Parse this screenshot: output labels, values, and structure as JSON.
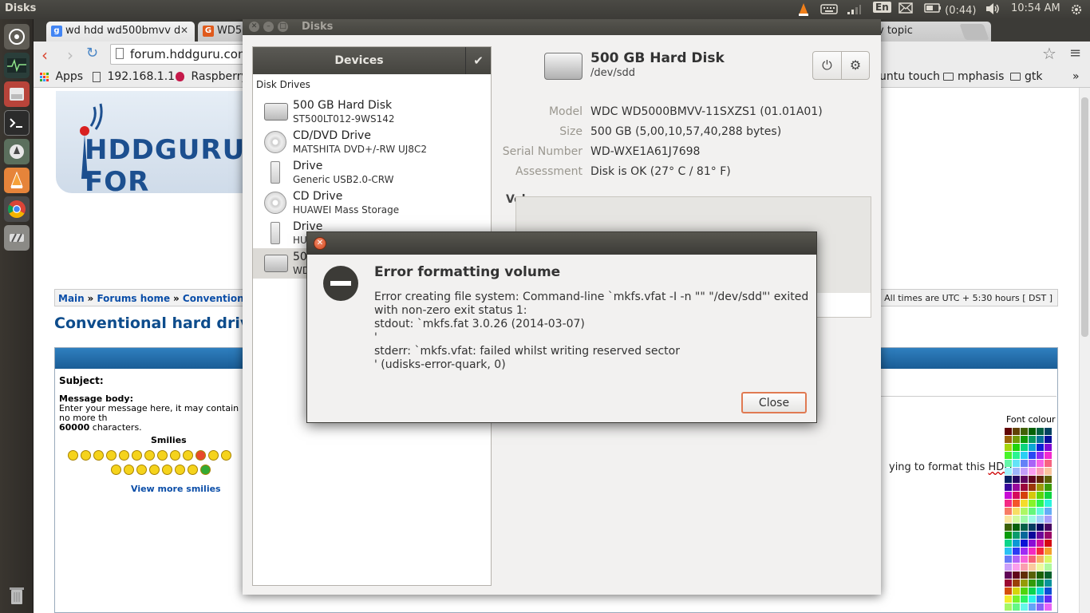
{
  "panel": {
    "app_title": "Disks",
    "battery": "(0:44)",
    "clock": "10:54 AM",
    "keyboard_lang": "En"
  },
  "browser": {
    "tabs": [
      {
        "label": "wd hdd wd500bmvv d",
        "favicon": "google-icon"
      },
      {
        "label": "WD5",
        "favicon": "hddguru-icon"
      },
      {
        "label": "v topic",
        "favicon": ""
      }
    ],
    "url": "forum.hddguru.com",
    "bookmarks": [
      {
        "label": "Apps"
      },
      {
        "label": "192.168.1.1"
      },
      {
        "label": "Raspberry"
      },
      {
        "label": "untu touch"
      },
      {
        "label": "mphasis"
      },
      {
        "label": "gtk"
      }
    ],
    "page": {
      "logo_text": "HDDGURU FOR",
      "breadcrumb": [
        "Main",
        "Forums home",
        "Conventional har"
      ],
      "timezone": "All times are UTC + 5:30 hours [ DST ]",
      "title": "Conventional hard drives",
      "subject_label": "Subject:",
      "message_label": "Message body:",
      "message_hint": "Enter your message here, it may contain no more th",
      "message_limit": "60000",
      "message_limit_suffix": " characters.",
      "smilies_label": "Smilies",
      "more_smilies": "View more smilies",
      "helper_text_prefix": "ying to format this ",
      "helper_text_word": "HDD",
      "font_colour_label": "Font colour"
    }
  },
  "disks": {
    "window_title": "Disks",
    "devices_header": "Devices",
    "section_label": "Disk Drives",
    "devices": [
      {
        "name": "500 GB Hard Disk",
        "sub": "ST500LT012-9WS142",
        "icon": "hdd-icon"
      },
      {
        "name": "CD/DVD Drive",
        "sub": "MATSHITA DVD+/-RW UJ8C2",
        "icon": "cd-icon"
      },
      {
        "name": "Drive",
        "sub": "Generic USB2.0-CRW",
        "icon": "usb-icon"
      },
      {
        "name": "CD Drive",
        "sub": "HUAWEI Mass Storage",
        "icon": "cd-icon"
      },
      {
        "name": "Drive",
        "sub": "HU",
        "icon": "usb-icon"
      },
      {
        "name": "500",
        "sub": "WD",
        "icon": "usb-hdd-icon"
      }
    ],
    "selected": {
      "title": "500 GB Hard Disk",
      "device": "/dev/sdd",
      "props": [
        {
          "key": "Model",
          "value": "WDC WD5000BMVV-11SXZS1 (01.01A01)"
        },
        {
          "key": "Size",
          "value": "500 GB (5,00,10,57,40,288 bytes)"
        },
        {
          "key": "Serial Number",
          "value": "WD-WXE1A61J7698"
        },
        {
          "key": "Assessment",
          "value": "Disk is OK (27° C / 81° F)"
        }
      ],
      "volumes_label": "Volumes"
    }
  },
  "dialog": {
    "heading": "Error formatting volume",
    "lines": [
      "Error creating file system: Command-line `mkfs.vfat -I -n \"\" \"/dev/sdd\"' exited",
      "with non-zero exit status 1:",
      "stdout: `mkfs.fat 3.0.26 (2014-03-07)",
      "'",
      "stderr: `mkfs.vfat: failed whilst writing reserved sector",
      "' (udisks-error-quark, 0)"
    ],
    "close_label": "Close"
  },
  "colors": {
    "panel_bg": "#3c3b37",
    "accent_orange": "#e07a52",
    "link_blue": "#0b4ea8"
  }
}
